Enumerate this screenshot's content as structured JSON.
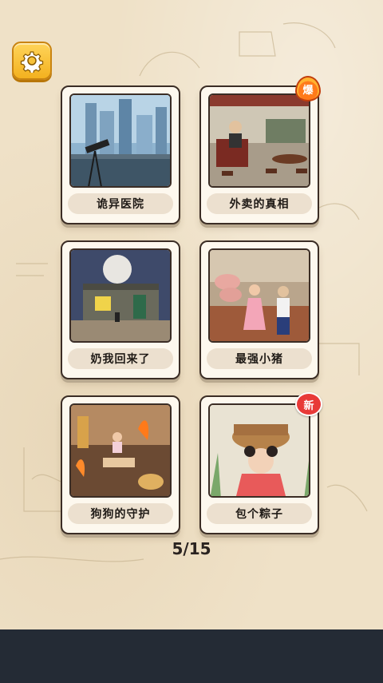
{
  "settings": {
    "icon": "gear-icon"
  },
  "levels": [
    {
      "title": "诡异医院",
      "badge": null
    },
    {
      "title": "外卖的真相",
      "badge": "爆"
    },
    {
      "title": "奶我回来了",
      "badge": null
    },
    {
      "title": "最强小猪",
      "badge": null
    },
    {
      "title": "狗狗的守护",
      "badge": null
    },
    {
      "title": "包个粽子",
      "badge": "新"
    }
  ],
  "pagination": {
    "text": "5/15"
  },
  "colors": {
    "background": "#efe1c7",
    "button": "#f7c23a",
    "card_border": "#3b2d25",
    "label_bg": "#ece0cf",
    "bottom_bar": "#242b35"
  }
}
